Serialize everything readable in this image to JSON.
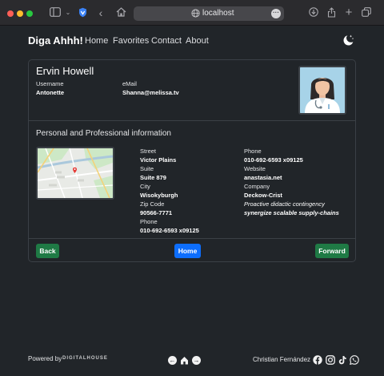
{
  "browser": {
    "url": "localhost"
  },
  "nav": {
    "brand": "Diga Ahhh!",
    "links": [
      "Home",
      "Favorites",
      "Contact",
      "About"
    ],
    "theme_icon": "moon-stars-icon"
  },
  "profile": {
    "name": "Ervin Howell",
    "username_label": "Username",
    "username": "Antonette",
    "email_label": "eMail",
    "email": "Shanna@melissa.tv",
    "avatar_icon": "doctor-avatar"
  },
  "details": {
    "section_title": "Personal and Professional information",
    "street_label": "Street",
    "street": "Victor Plains",
    "suite_label": "Suite",
    "suite": "Suite 879",
    "city_label": "City",
    "city": "Wisokyburgh",
    "zip_label": "Zip Code",
    "zip": "90566-7771",
    "phone_label": "Phone",
    "phone": "010-692-6593 x09125",
    "phone2_label": "Phone",
    "phone2": "010-692-6593 x09125",
    "website_label": "Website",
    "website": "anastasia.net",
    "company_label": "Company",
    "company": "Deckow-Crist",
    "catch_phrase": "Proactive didactic contingency",
    "bs": "synergize scalable supply-chains"
  },
  "actions": {
    "back": "Back",
    "home": "Home",
    "forward": "Forward"
  },
  "footer": {
    "powered_by": "Powered by",
    "brand": "DIGITALHOUSE",
    "author": "Christian Fernández"
  },
  "colors": {
    "background": "#212529",
    "primary": "#0d6efd",
    "success": "#1f7a45"
  }
}
